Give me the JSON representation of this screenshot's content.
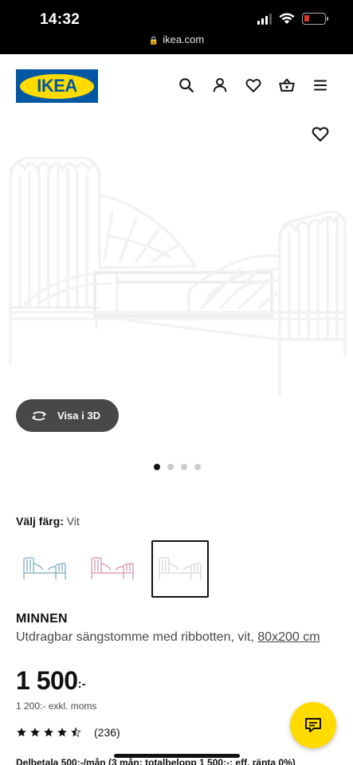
{
  "status_bar": {
    "time": "14:32",
    "url": "ikea.com"
  },
  "header": {
    "logo_text": "IKEA",
    "brand_colors": {
      "blue": "#0058a3",
      "yellow": "#ffdb00"
    },
    "icons": [
      "search-icon",
      "account-icon",
      "wishlist-icon",
      "cart-icon",
      "menu-icon"
    ]
  },
  "product_image": {
    "view_3d_label": "Visa i 3D",
    "image_count": 4,
    "active_index": 0
  },
  "color": {
    "label": "Välj färg:",
    "value": "Vit",
    "options": [
      {
        "name": "blue-bed-swatch",
        "color": "#8fb7c7",
        "selected": false
      },
      {
        "name": "pink-bed-swatch",
        "color": "#d9a3b8",
        "selected": false
      },
      {
        "name": "white-bed-swatch",
        "color": "#e4e4e4",
        "selected": true
      }
    ]
  },
  "product": {
    "name": "MINNEN",
    "description": "Utdragbar sängstomme med ribbotten, vit,",
    "size": "80x200 cm",
    "price": "1 500",
    "price_suffix": ":-",
    "excl_vat": "1 200:- exkl. moms",
    "rating": 4.5,
    "review_count": "(236)",
    "installment": "Delbetala 500:-/mån (3 mån; totalbelopp 1 500:-; eff. ränta 0%)"
  }
}
